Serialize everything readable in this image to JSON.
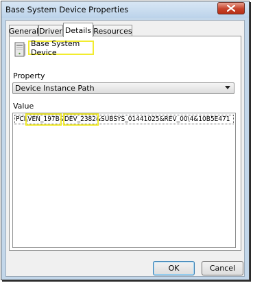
{
  "window": {
    "title": "Base System Device Properties",
    "close_label": "Close"
  },
  "tabs": [
    {
      "label": "General"
    },
    {
      "label": "Driver"
    },
    {
      "label": "Details"
    },
    {
      "label": "Resources"
    }
  ],
  "active_tab": "Details",
  "device": {
    "name": "Base System Device",
    "icon": "system-device-icon"
  },
  "property": {
    "label": "Property",
    "selected": "Device Instance Path"
  },
  "value": {
    "label": "Value",
    "parts": [
      "PCI\\",
      "VEN_197B",
      "&",
      "DEV_2382",
      "&SUBSYS_01441025&REV_00\\4&10B5E471"
    ]
  },
  "buttons": {
    "ok": "OK",
    "cancel": "Cancel"
  },
  "colors": {
    "highlight": "#f2ec2f",
    "close_button": "#c7432b",
    "title_bar": "#c3d7ea"
  }
}
